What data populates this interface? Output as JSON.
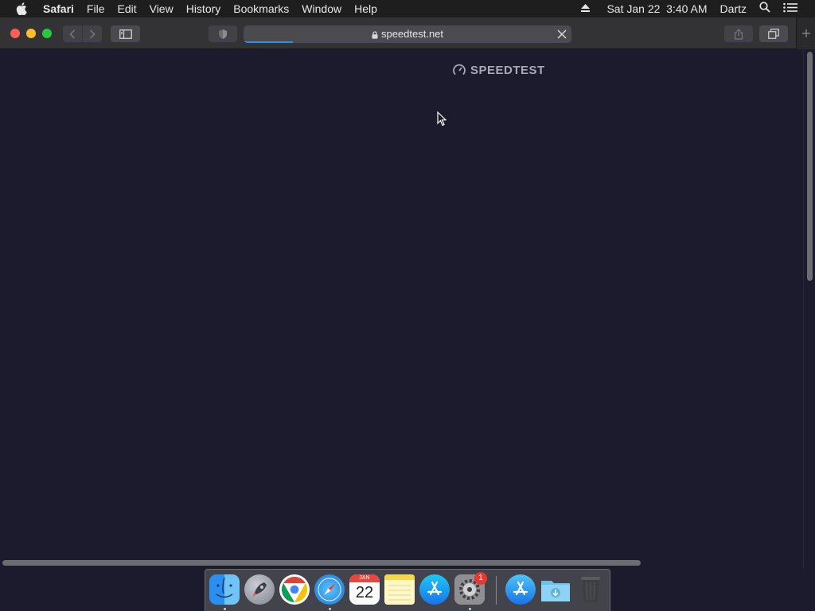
{
  "menubar": {
    "app_name": "Safari",
    "items": [
      "File",
      "Edit",
      "View",
      "History",
      "Bookmarks",
      "Window",
      "Help"
    ],
    "clock": "Sat Jan 22  3:40 AM",
    "user": "Dartz"
  },
  "toolbar": {
    "url": "speedtest.net",
    "load_progress": 0.15
  },
  "page": {
    "logo_text": "SPEEDTEST"
  },
  "dock": {
    "calendar_month": "JAN",
    "calendar_day": "22",
    "prefs_badge": "1"
  },
  "colors": {
    "page_background": "#1c1b2e",
    "accent_blue": "#2f8ee6",
    "badge_red": "#e8382d"
  }
}
